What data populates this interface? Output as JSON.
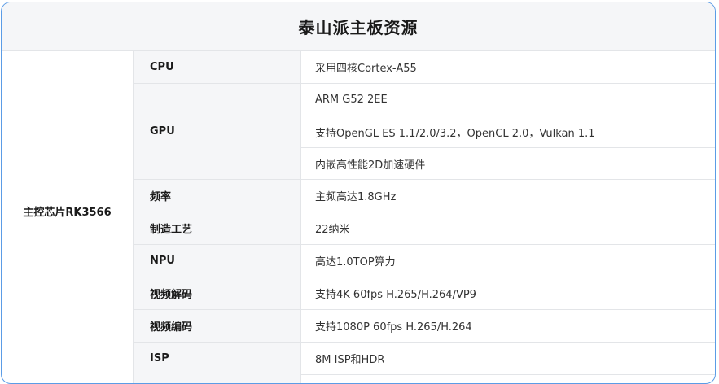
{
  "table": {
    "title": "泰山派主板资源",
    "chip_label": "主控芯片RK3566",
    "rows": [
      {
        "label": "CPU",
        "values": [
          "采用四核Cortex-A55"
        ]
      },
      {
        "label": "GPU",
        "values": [
          "ARM G52 2EE",
          "支持OpenGL ES 1.1/2.0/3.2，OpenCL 2.0，Vulkan 1.1",
          "内嵌高性能2D加速硬件"
        ]
      },
      {
        "label": "频率",
        "values": [
          "主频高达1.8GHz"
        ]
      },
      {
        "label": "制造工艺",
        "values": [
          "22纳米"
        ]
      },
      {
        "label": "NPU",
        "values": [
          "高达1.0TOP算力"
        ]
      },
      {
        "label": "视频解码",
        "values": [
          "支持4K 60fps H.265/H.264/VP9"
        ]
      },
      {
        "label": "视频编码",
        "values": [
          "支持1080P 60fps H.265/H.264"
        ]
      },
      {
        "label": "ISP",
        "values": [
          "8M ISP和HDR"
        ]
      }
    ]
  }
}
